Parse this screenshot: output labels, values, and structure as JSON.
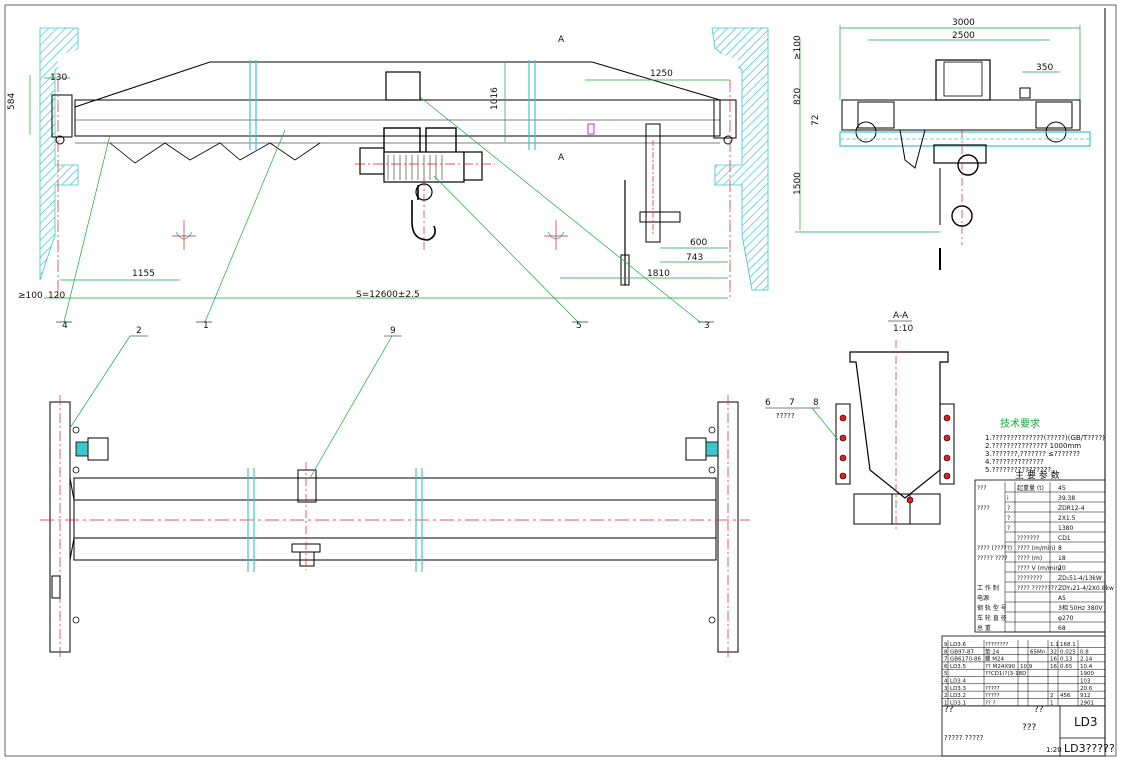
{
  "drawing": {
    "section_marker_top": "A",
    "section_marker_bottom": "A",
    "section_title": "A-A",
    "section_scale": "1:10"
  },
  "front_view_dims": {
    "d130": "130",
    "d584": "584",
    "d1016": "1016",
    "d1250": "1250",
    "d1155": "1155",
    "d100": "≥100",
    "d120": "120",
    "span": "S=12600±2.5",
    "d600": "600",
    "d743": "743",
    "d1810": "1810"
  },
  "side_view_dims": {
    "d3000": "3000",
    "d2500": "2500",
    "d100": "≥100",
    "d820": "820",
    "d350": "350",
    "d72": "72",
    "d1500": "1500"
  },
  "balloons": [
    "4",
    "2",
    "1",
    "9",
    "5",
    "3",
    "6",
    "7",
    "8"
  ],
  "balloon_note": "?????",
  "tech_requirements": {
    "title": "技术要求",
    "lines": [
      "1.??????????????(?????)(GB/T????)",
      "2.??????????????? 1000mm",
      "3.???????,??????? ≤???????",
      "4.??????????????",
      "5.????????????????"
    ]
  },
  "params_table": {
    "header": "主 要 参 数",
    "rows": [
      {
        "group": "???",
        "sub": "",
        "col2": "起重量 (t)",
        "val": "45"
      },
      {
        "group": "",
        "sub": "i",
        "col2": "",
        "val": "39.38"
      },
      {
        "group": "????",
        "sub": "?",
        "col2": "",
        "val": "ZDR12-4"
      },
      {
        "group": "",
        "sub": "?",
        "col2": "",
        "val": "2X1.5"
      },
      {
        "group": "",
        "sub": "?",
        "col2": "",
        "val": "1380"
      },
      {
        "group": "",
        "sub": "",
        "col2": "???????",
        "val": "CD1"
      },
      {
        "group": "???? (?????)",
        "sub": "",
        "col2": "????  (m/min)",
        "val": "8"
      },
      {
        "group": "????? ????",
        "sub": "",
        "col2": "????  (m)",
        "val": "18"
      },
      {
        "group": "",
        "sub": "",
        "col2": "????  V  (m/min)",
        "val": "20"
      },
      {
        "group": "",
        "sub": "",
        "col2": "????????",
        "val": "ZD₁51-4/13kW"
      },
      {
        "group": "工 作 制",
        "sub": "",
        "col2": "???? ????????",
        "val": "ZDY₁21-4/2X0.8kw"
      },
      {
        "group": "电源",
        "sub": "",
        "col2": "",
        "val": "A5"
      },
      {
        "group": "钢 轨 型 号",
        "sub": "",
        "col2": "",
        "val": "3相 50Hz  380V"
      },
      {
        "group": "车 轮 直 径",
        "sub": "",
        "col2": "",
        "val": "φ270"
      },
      {
        "group": "总 重",
        "sub": "",
        "col2": "",
        "val": "68"
      }
    ]
  },
  "parts_list": {
    "rows": [
      {
        "no": "9",
        "code": "LD3.6",
        "name": "????????",
        "qty": "",
        "mat": "",
        "w1": "1.1",
        "w2": "168.1"
      },
      {
        "no": "8",
        "code": "GB97-87",
        "name": "垫 24",
        "qty": "",
        "mat": "65Mn",
        "w1": "32",
        "w2": "0.025",
        "w3": "0.8"
      },
      {
        "no": "7",
        "code": "GB6170-86",
        "name": "螺 M24",
        "qty": "",
        "mat": "",
        "w1": "16",
        "w2": "0.13",
        "w3": "2.14"
      },
      {
        "no": "6",
        "code": "LD3.5",
        "name": "?? M24X90",
        "qty": "10.9",
        "mat": "",
        "w1": "16",
        "w2": "0.65",
        "w3": "10.4"
      },
      {
        "no": "5",
        "code": "",
        "name": "??CD1(?)3-18D",
        "qty": "",
        "mat": "",
        "w1": "",
        "w2": "",
        "w3": "1900"
      },
      {
        "no": "4",
        "code": "LD3.4",
        "name": "",
        "qty": "",
        "mat": "",
        "w1": "",
        "w2": "",
        "w3": "103"
      },
      {
        "no": "3",
        "code": "LD3.3",
        "name": "?????",
        "qty": "",
        "mat": "",
        "w1": "",
        "w2": "",
        "w3": "20.6"
      },
      {
        "no": "2",
        "code": "LD3.2",
        "name": "?????",
        "qty": "",
        "mat": "",
        "w1": "2",
        "w2": "456",
        "w3": "912"
      },
      {
        "no": "1",
        "code": "LD3.1",
        "name": "?? ?",
        "qty": "",
        "mat": "",
        "w1": "1",
        "w2": "",
        "w3": "2901"
      }
    ],
    "caption_left": "??",
    "caption_mid": "??",
    "caption_code": "LD3",
    "caption_name": "???",
    "caption_scale": "1:20",
    "footer_title": "LD3?????",
    "footer_left": "?????  ?????"
  }
}
